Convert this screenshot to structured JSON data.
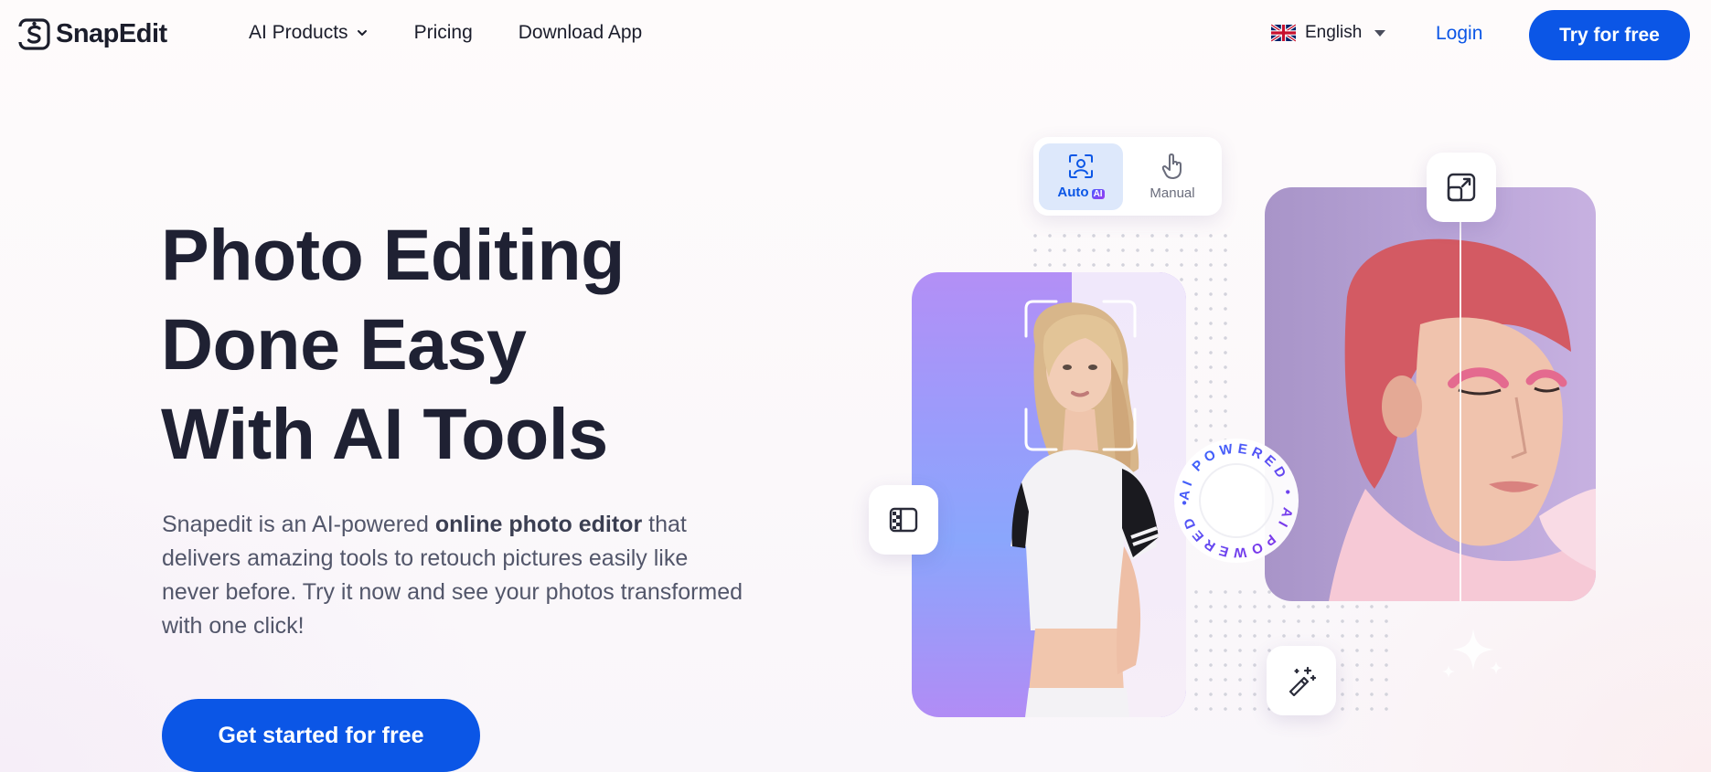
{
  "header": {
    "brand": "SnapEdit",
    "nav": [
      {
        "label": "AI Products",
        "has_dropdown": true
      },
      {
        "label": "Pricing"
      },
      {
        "label": "Download App"
      }
    ],
    "language": {
      "label": "English",
      "flag": "uk-flag-icon"
    },
    "login_label": "Login",
    "try_label": "Try for free"
  },
  "hero": {
    "title_lines": [
      "Photo Editing",
      "Done Easy",
      "With AI Tools"
    ],
    "desc_prefix": "Snapedit is an AI-powered ",
    "desc_bold": "online photo editor",
    "desc_suffix": " that delivers amazing tools to retouch pictures easily like never before. Try it now and see your photos transformed with one click!",
    "cta_label": "Get started for free"
  },
  "illustration": {
    "modes": [
      {
        "label": "Auto",
        "chip": "AI",
        "active": true,
        "icon": "face-scan-icon"
      },
      {
        "label": "Manual",
        "active": false,
        "icon": "hand-pointer-icon"
      }
    ],
    "badge_text": "AI POWERED • AI POWERED •",
    "icons": [
      "expand-icon",
      "compare-icon",
      "magic-wand-icon",
      "sparkle-icon"
    ]
  },
  "colors": {
    "primary": "#0b56e6",
    "text_dark": "#1f2133",
    "text_muted": "#52566a"
  }
}
